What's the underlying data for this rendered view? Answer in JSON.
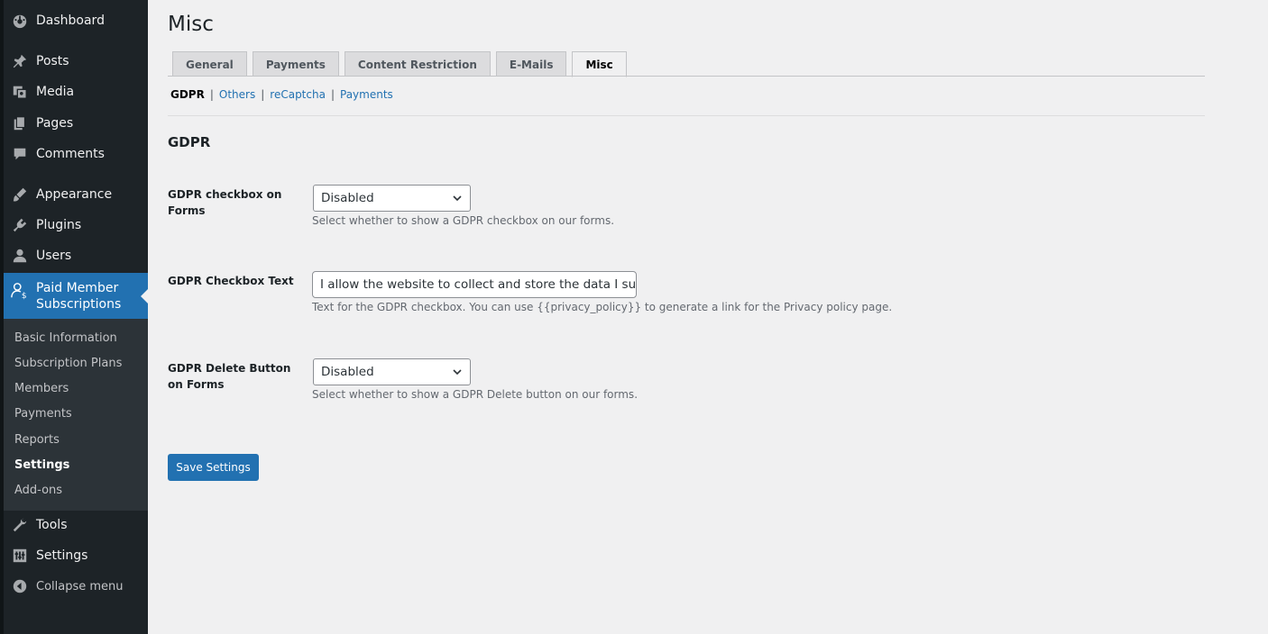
{
  "sidebar": {
    "menu": [
      {
        "label": "Dashboard",
        "icon": "dashboard-icon"
      },
      {
        "label": "Posts",
        "icon": "pin-icon"
      },
      {
        "label": "Media",
        "icon": "media-icon"
      },
      {
        "label": "Pages",
        "icon": "pages-icon"
      },
      {
        "label": "Comments",
        "icon": "comments-icon"
      },
      {
        "label": "Appearance",
        "icon": "appearance-icon"
      },
      {
        "label": "Plugins",
        "icon": "plugins-icon"
      },
      {
        "label": "Users",
        "icon": "users-icon"
      }
    ],
    "active": {
      "label_line1": "Paid Member",
      "label_line2": "Subscriptions",
      "icon": "member-icon"
    },
    "submenu": [
      "Basic Information",
      "Subscription Plans",
      "Members",
      "Payments",
      "Reports",
      "Settings",
      "Add-ons"
    ],
    "submenu_current": "Settings",
    "menu_after": [
      {
        "label": "Tools",
        "icon": "tools-icon"
      },
      {
        "label": "Settings",
        "icon": "settings-icon"
      }
    ],
    "collapse_label": "Collapse menu"
  },
  "page": {
    "title": "Misc",
    "tabs": [
      "General",
      "Payments",
      "Content Restriction",
      "E-Mails",
      "Misc"
    ],
    "active_tab": "Misc",
    "subnav": [
      "GDPR",
      "Others",
      "reCaptcha",
      "Payments"
    ],
    "subnav_current": "GDPR",
    "section_title": "GDPR",
    "fields": {
      "checkbox": {
        "label_line1": "GDPR checkbox on",
        "label_line2": "Forms",
        "value": "Disabled",
        "description": "Select whether to show a GDPR checkbox on our forms."
      },
      "checkbox_text": {
        "label": "GDPR Checkbox Text",
        "value": "I allow the website to collect and store the data I submit through this form.",
        "description": "Text for the GDPR checkbox. You can use {{privacy_policy}} to generate a link for the Privacy policy page."
      },
      "delete_button": {
        "label_line1": "GDPR Delete Button",
        "label_line2": "on Forms",
        "value": "Disabled",
        "description": "Select whether to show a GDPR Delete button on our forms."
      }
    },
    "save_label": "Save Settings"
  },
  "colors": {
    "sidebar_bg": "#1d2327",
    "accent": "#2271b1",
    "submenu_bg": "#2c3338",
    "page_bg": "#f0f0f1"
  }
}
